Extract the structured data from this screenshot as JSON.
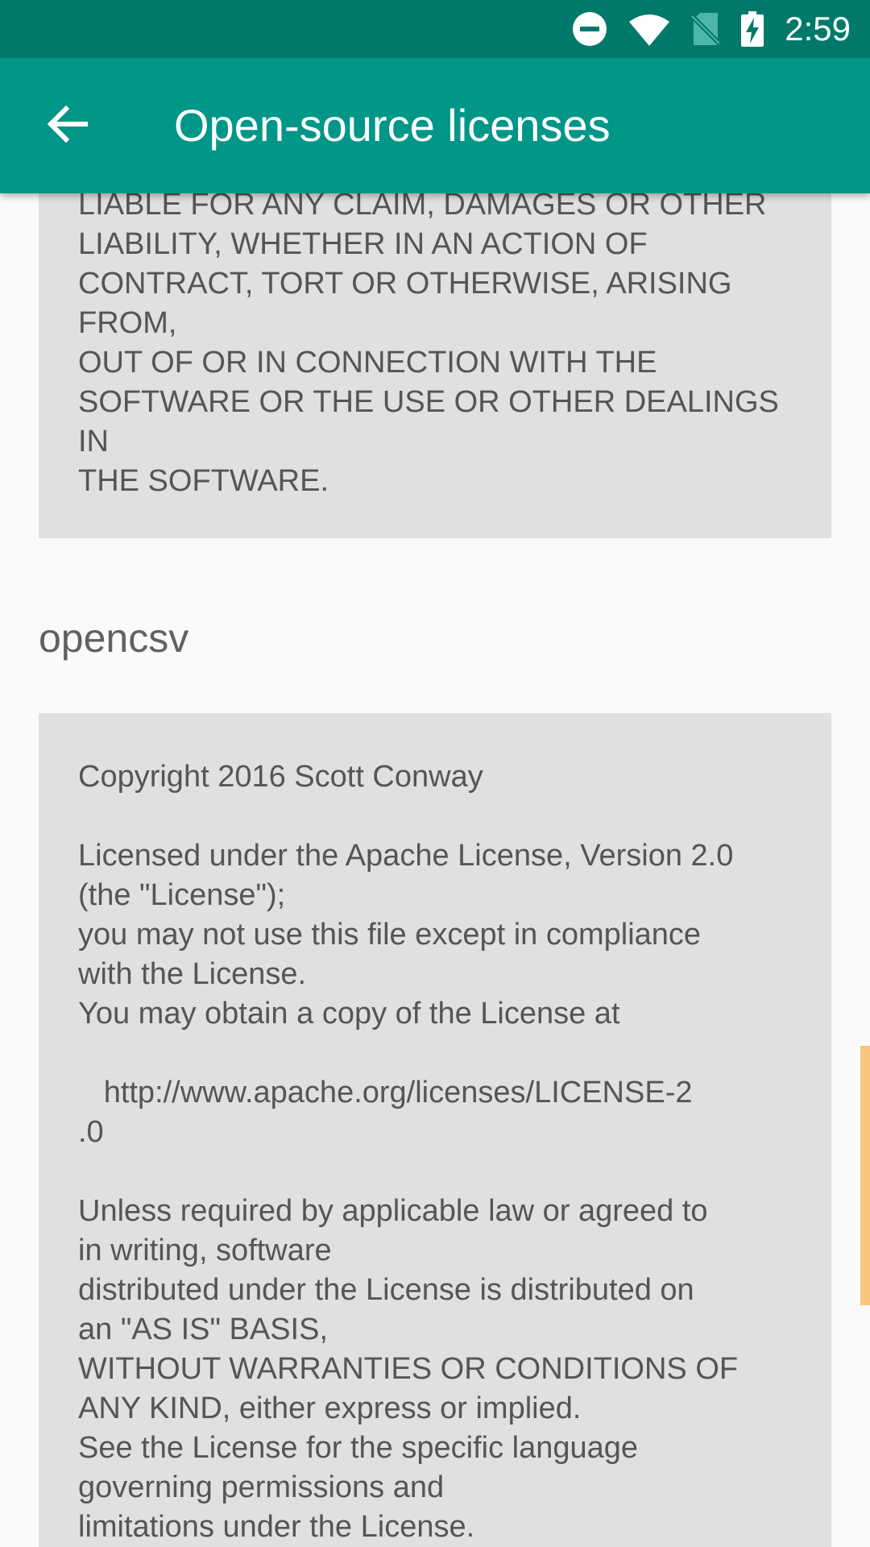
{
  "status_bar": {
    "time": "2:59",
    "icons": [
      "do-not-disturb-icon",
      "wifi-icon",
      "no-sim-icon",
      "battery-charging-icon"
    ]
  },
  "app_bar": {
    "back_icon": "arrow-back-icon",
    "title": "Open-source licenses"
  },
  "licenses": [
    {
      "name": "",
      "text": "LIABLE FOR ANY CLAIM, DAMAGES OR OTHER\nLIABILITY, WHETHER IN AN ACTION OF\nCONTRACT, TORT OR OTHERWISE, ARISING\nFROM,\nOUT OF OR IN CONNECTION WITH THE\nSOFTWARE OR THE USE OR OTHER DEALINGS\nIN\nTHE SOFTWARE."
    },
    {
      "name": "opencsv",
      "text": "Copyright 2016 Scott Conway\n\nLicensed under the Apache License, Version 2.0\n(the \"License\");\nyou may not use this file except in compliance\nwith the License.\nYou may obtain a copy of the License at\n\n   http://www.apache.org/licenses/LICENSE-2\n.0\n\nUnless required by applicable law or agreed to\nin writing, software\ndistributed under the License is distributed on\nan \"AS IS\" BASIS,\nWITHOUT WARRANTIES OR CONDITIONS OF\nANY KIND, either express or implied.\nSee the License for the specific language\ngoverning permissions and\nlimitations under the License."
    }
  ],
  "colors": {
    "status_bar": "#00796b",
    "app_bar": "#009688",
    "background": "#fafafa",
    "license_box": "#e0e0e0",
    "scroll_thumb": "#f9c57d"
  }
}
